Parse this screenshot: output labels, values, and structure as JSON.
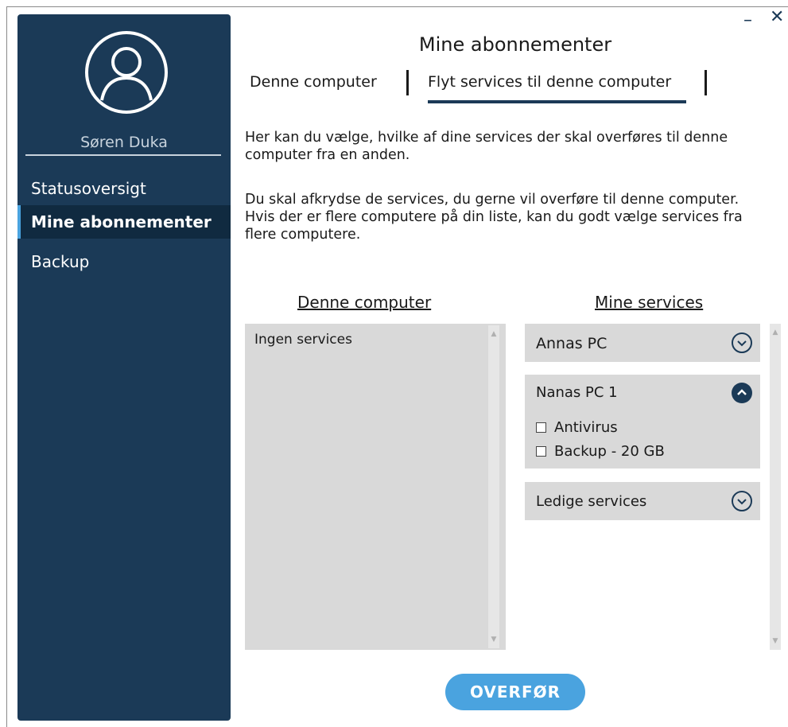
{
  "user": {
    "name": "Søren Duka"
  },
  "sidebar": {
    "items": [
      {
        "label": "Statusoversigt",
        "active": false
      },
      {
        "label": "Mine abonnementer",
        "active": true
      },
      {
        "label": "Backup",
        "active": false
      }
    ]
  },
  "window": {
    "minimize": "–",
    "close": "✕"
  },
  "page": {
    "title": "Mine abonnementer",
    "tabs": [
      {
        "label": "Denne computer",
        "active": false
      },
      {
        "label": "Flyt services til denne computer",
        "active": true
      }
    ],
    "intro1": "Her kan du vælge, hvilke af dine services der skal overføres til denne computer fra en anden.",
    "intro2": "Du skal afkrydse de services, du gerne vil overføre til denne computer. Hvis der er flere computere på din liste, kan du godt vælge services fra flere computere."
  },
  "left_panel": {
    "heading": "Denne computer",
    "empty_text": "Ingen services"
  },
  "right_panel": {
    "heading": "Mine services",
    "cards": [
      {
        "title": "Annas PC",
        "expanded": false,
        "icon": "chevron-down-circle-icon"
      },
      {
        "title": "Nanas PC 1",
        "expanded": true,
        "icon": "chevron-up-circle-icon",
        "services": [
          {
            "label": "Antivirus",
            "checked": false
          },
          {
            "label": "Backup - 20 GB",
            "checked": false
          }
        ]
      },
      {
        "title": "Ledige services",
        "expanded": false,
        "icon": "chevron-down-circle-icon"
      }
    ]
  },
  "actions": {
    "transfer": "OVERFØR"
  },
  "colors": {
    "sidebar": "#1b3a57",
    "accent": "#4aa3df",
    "panel": "#d9d9d9"
  }
}
